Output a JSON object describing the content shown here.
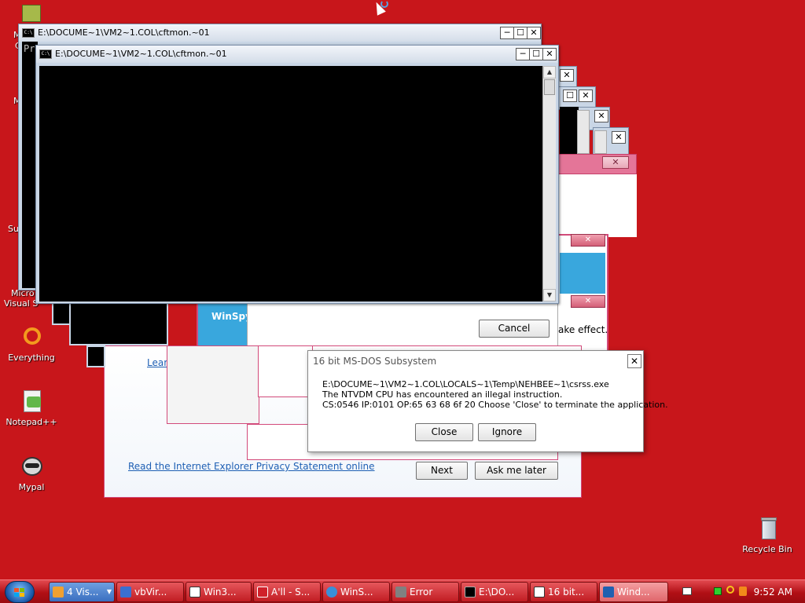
{
  "desktop": {
    "icons": [
      {
        "label": "Everything",
        "icon": "everything-icon"
      },
      {
        "label": "Notepad++",
        "icon": "notepad-plus-icon"
      },
      {
        "label": "Mypal",
        "icon": "mypal-raccoon-icon"
      },
      {
        "label": "Recycle Bin",
        "icon": "recycle-bin-icon"
      }
    ],
    "partial_labels": [
      {
        "text": "M"
      },
      {
        "text": "C"
      },
      {
        "text": "M"
      },
      {
        "text": "Su"
      },
      {
        "text": "Micro"
      },
      {
        "text": "Visual S"
      }
    ]
  },
  "console_back": {
    "title": "E:\\DOCUME~1\\VM2~1.COL\\cftmon.~01",
    "snippet": "Pr"
  },
  "console_front": {
    "title": "E:\\DOCUME~1\\VM2~1.COL\\cftmon.~01"
  },
  "window_buttons": {
    "minimize": "─",
    "maximize": "☐",
    "close": "✕"
  },
  "winspy_label": "WinSpy",
  "effect_text": "ake effect.",
  "cancel_button": "Cancel",
  "ie_dialog": {
    "learn_link": "Lear",
    "privacy_link": "Read the Internet Explorer Privacy Statement online",
    "next_button": "Next",
    "ask_later_button": "Ask me later"
  },
  "ntvdm_dialog": {
    "title": "16 bit MS-DOS Subsystem",
    "line1": "E:\\DOCUME~1\\VM2~1.COL\\LOCALS~1\\Temp\\NEHBEE~1\\csrss.exe",
    "line2": "The NTVDM CPU has encountered an illegal instruction.",
    "line3": "CS:0546 IP:0101 OP:65 63 68 6f 20 Choose 'Close' to terminate the application.",
    "close_button": "Close",
    "ignore_button": "Ignore"
  },
  "taskbar": {
    "items": [
      {
        "label": "4 Vis...",
        "icon": "folder-group-icon",
        "color": "#f0a030"
      },
      {
        "label": "vbVir...",
        "icon": "vb-icon",
        "color": "#3a6fd0"
      },
      {
        "label": "Win3...",
        "icon": "window-icon",
        "color": "#ffffff"
      },
      {
        "label": "A'll - S...",
        "icon": "ati-icon",
        "color": "#d0202a"
      },
      {
        "label": "WinS...",
        "icon": "globe-icon",
        "color": "#3a8fd8"
      },
      {
        "label": "Error",
        "icon": "error-app-icon",
        "color": "#808080"
      },
      {
        "label": "E:\\DO...",
        "icon": "console-icon",
        "color": "#000000"
      },
      {
        "label": "16 bit...",
        "icon": "window-icon",
        "color": "#ffffff"
      },
      {
        "label": "Wind...",
        "icon": "winspy-icon",
        "color": "#2060b0",
        "active": true
      }
    ],
    "clock": "9:52 AM",
    "tray_icons": [
      "network-icon",
      "green-status-icon",
      "search-icon",
      "info-icon"
    ]
  },
  "colors": {
    "desktop": "#c8161b",
    "accent_pink": "#d24a7a",
    "winspy_blue": "#39a7dd"
  }
}
